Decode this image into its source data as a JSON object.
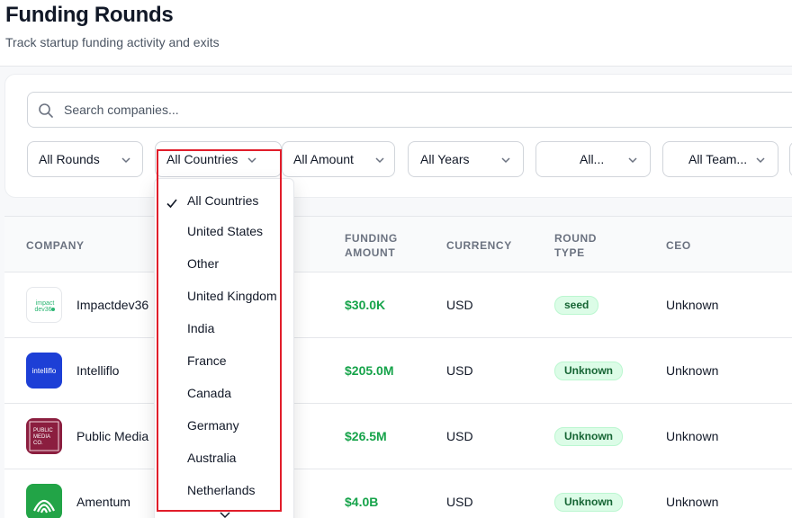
{
  "header": {
    "title": "Funding Rounds",
    "subtitle": "Track startup funding activity and exits"
  },
  "search": {
    "placeholder": "Search companies...",
    "value": ""
  },
  "filters": [
    {
      "label": "All Rounds"
    },
    {
      "label": "All Countries"
    },
    {
      "label": "All Amount"
    },
    {
      "label": "All Years"
    },
    {
      "label": "All..."
    },
    {
      "label": "All Team..."
    }
  ],
  "table": {
    "columns": [
      "Company",
      "Funding Amount",
      "Currency",
      "Round Type",
      "CEO"
    ],
    "rows": [
      {
        "company": "Impactdev36",
        "logo_text": "impact dev36",
        "logo_color": "#ffffff",
        "amount": "$30.0K",
        "currency": "USD",
        "round": "seed",
        "ceo": "Unknown"
      },
      {
        "company": "Intelliflo",
        "logo_text": "intelliflo",
        "logo_color": "#1d3fd6",
        "amount": "$205.0M",
        "currency": "USD",
        "round": "Unknown",
        "ceo": "Unknown"
      },
      {
        "company": "Public Media",
        "logo_text": "PUBLIC MEDIA CO.",
        "logo_color": "#8b1e3f",
        "amount": "$26.5M",
        "currency": "USD",
        "round": "Unknown",
        "ceo": "Unknown"
      },
      {
        "company": "Amentum",
        "logo_text": "",
        "logo_color": "#22a447",
        "amount": "$4.0B",
        "currency": "USD",
        "round": "Unknown",
        "ceo": "Unknown"
      }
    ]
  },
  "country_dropdown": {
    "selected": "All Countries",
    "options": [
      "All Countries",
      "United States",
      "Other",
      "United Kingdom",
      "India",
      "France",
      "Canada",
      "Germany",
      "Australia",
      "Netherlands"
    ]
  },
  "colors": {
    "accent_green": "#16a34a",
    "badge_bg": "#dcfce7",
    "highlight_red": "#e11d2a"
  }
}
